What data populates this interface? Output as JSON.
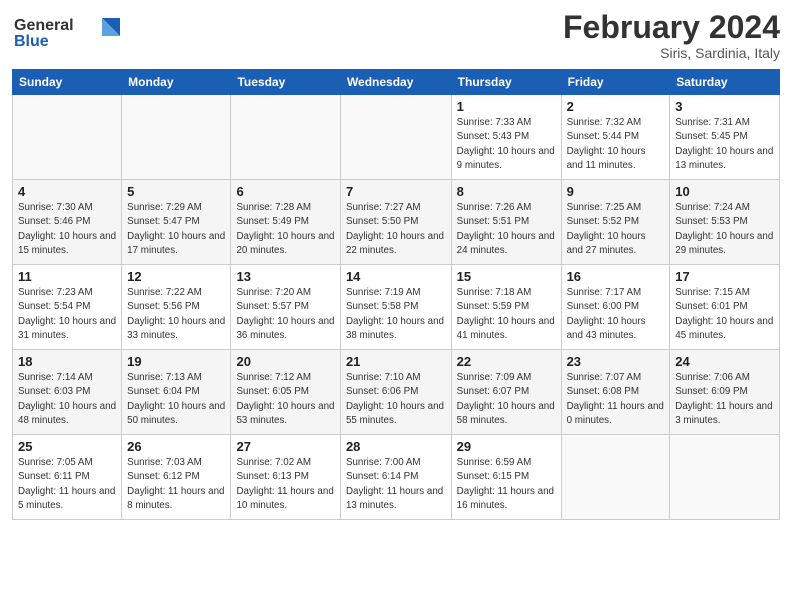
{
  "header": {
    "title": "February 2024",
    "location": "Siris, Sardinia, Italy"
  },
  "calendar": {
    "headers": [
      "Sunday",
      "Monday",
      "Tuesday",
      "Wednesday",
      "Thursday",
      "Friday",
      "Saturday"
    ],
    "weeks": [
      [
        {
          "day": "",
          "info": ""
        },
        {
          "day": "",
          "info": ""
        },
        {
          "day": "",
          "info": ""
        },
        {
          "day": "",
          "info": ""
        },
        {
          "day": "1",
          "info": "Sunrise: 7:33 AM\nSunset: 5:43 PM\nDaylight: 10 hours\nand 9 minutes."
        },
        {
          "day": "2",
          "info": "Sunrise: 7:32 AM\nSunset: 5:44 PM\nDaylight: 10 hours\nand 11 minutes."
        },
        {
          "day": "3",
          "info": "Sunrise: 7:31 AM\nSunset: 5:45 PM\nDaylight: 10 hours\nand 13 minutes."
        }
      ],
      [
        {
          "day": "4",
          "info": "Sunrise: 7:30 AM\nSunset: 5:46 PM\nDaylight: 10 hours\nand 15 minutes."
        },
        {
          "day": "5",
          "info": "Sunrise: 7:29 AM\nSunset: 5:47 PM\nDaylight: 10 hours\nand 17 minutes."
        },
        {
          "day": "6",
          "info": "Sunrise: 7:28 AM\nSunset: 5:49 PM\nDaylight: 10 hours\nand 20 minutes."
        },
        {
          "day": "7",
          "info": "Sunrise: 7:27 AM\nSunset: 5:50 PM\nDaylight: 10 hours\nand 22 minutes."
        },
        {
          "day": "8",
          "info": "Sunrise: 7:26 AM\nSunset: 5:51 PM\nDaylight: 10 hours\nand 24 minutes."
        },
        {
          "day": "9",
          "info": "Sunrise: 7:25 AM\nSunset: 5:52 PM\nDaylight: 10 hours\nand 27 minutes."
        },
        {
          "day": "10",
          "info": "Sunrise: 7:24 AM\nSunset: 5:53 PM\nDaylight: 10 hours\nand 29 minutes."
        }
      ],
      [
        {
          "day": "11",
          "info": "Sunrise: 7:23 AM\nSunset: 5:54 PM\nDaylight: 10 hours\nand 31 minutes."
        },
        {
          "day": "12",
          "info": "Sunrise: 7:22 AM\nSunset: 5:56 PM\nDaylight: 10 hours\nand 33 minutes."
        },
        {
          "day": "13",
          "info": "Sunrise: 7:20 AM\nSunset: 5:57 PM\nDaylight: 10 hours\nand 36 minutes."
        },
        {
          "day": "14",
          "info": "Sunrise: 7:19 AM\nSunset: 5:58 PM\nDaylight: 10 hours\nand 38 minutes."
        },
        {
          "day": "15",
          "info": "Sunrise: 7:18 AM\nSunset: 5:59 PM\nDaylight: 10 hours\nand 41 minutes."
        },
        {
          "day": "16",
          "info": "Sunrise: 7:17 AM\nSunset: 6:00 PM\nDaylight: 10 hours\nand 43 minutes."
        },
        {
          "day": "17",
          "info": "Sunrise: 7:15 AM\nSunset: 6:01 PM\nDaylight: 10 hours\nand 45 minutes."
        }
      ],
      [
        {
          "day": "18",
          "info": "Sunrise: 7:14 AM\nSunset: 6:03 PM\nDaylight: 10 hours\nand 48 minutes."
        },
        {
          "day": "19",
          "info": "Sunrise: 7:13 AM\nSunset: 6:04 PM\nDaylight: 10 hours\nand 50 minutes."
        },
        {
          "day": "20",
          "info": "Sunrise: 7:12 AM\nSunset: 6:05 PM\nDaylight: 10 hours\nand 53 minutes."
        },
        {
          "day": "21",
          "info": "Sunrise: 7:10 AM\nSunset: 6:06 PM\nDaylight: 10 hours\nand 55 minutes."
        },
        {
          "day": "22",
          "info": "Sunrise: 7:09 AM\nSunset: 6:07 PM\nDaylight: 10 hours\nand 58 minutes."
        },
        {
          "day": "23",
          "info": "Sunrise: 7:07 AM\nSunset: 6:08 PM\nDaylight: 11 hours\nand 0 minutes."
        },
        {
          "day": "24",
          "info": "Sunrise: 7:06 AM\nSunset: 6:09 PM\nDaylight: 11 hours\nand 3 minutes."
        }
      ],
      [
        {
          "day": "25",
          "info": "Sunrise: 7:05 AM\nSunset: 6:11 PM\nDaylight: 11 hours\nand 5 minutes."
        },
        {
          "day": "26",
          "info": "Sunrise: 7:03 AM\nSunset: 6:12 PM\nDaylight: 11 hours\nand 8 minutes."
        },
        {
          "day": "27",
          "info": "Sunrise: 7:02 AM\nSunset: 6:13 PM\nDaylight: 11 hours\nand 10 minutes."
        },
        {
          "day": "28",
          "info": "Sunrise: 7:00 AM\nSunset: 6:14 PM\nDaylight: 11 hours\nand 13 minutes."
        },
        {
          "day": "29",
          "info": "Sunrise: 6:59 AM\nSunset: 6:15 PM\nDaylight: 11 hours\nand 16 minutes."
        },
        {
          "day": "",
          "info": ""
        },
        {
          "day": "",
          "info": ""
        }
      ]
    ]
  }
}
